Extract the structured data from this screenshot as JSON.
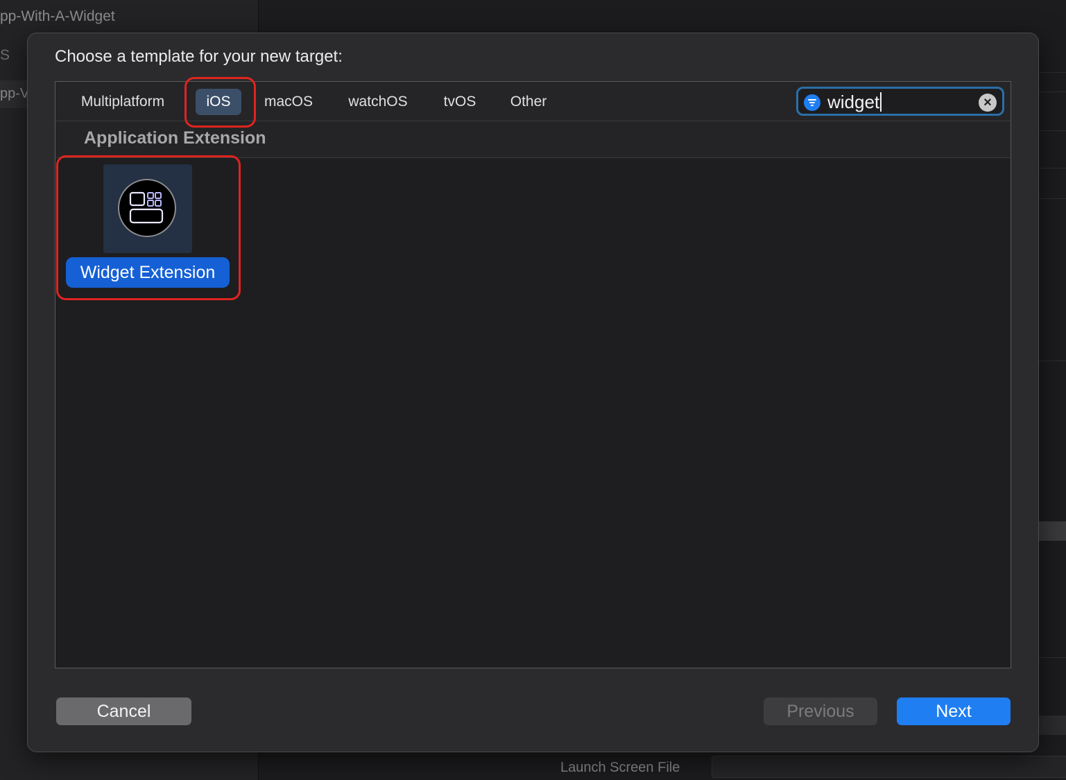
{
  "background": {
    "project_title": "pp-With-A-Widget",
    "sidebar_fragment": "S",
    "sidebar_row": "pp-V",
    "launch_screen_label": "Launch Screen File"
  },
  "sheet": {
    "title": "Choose a template for your new target:",
    "tabs": [
      {
        "label": "Multiplatform",
        "selected": false
      },
      {
        "label": "iOS",
        "selected": true
      },
      {
        "label": "macOS",
        "selected": false
      },
      {
        "label": "watchOS",
        "selected": false
      },
      {
        "label": "tvOS",
        "selected": false
      },
      {
        "label": "Other",
        "selected": false
      }
    ],
    "search": {
      "value": "widget",
      "filter_icon": "line-3-horizontal-decrease-circle-icon",
      "clear_icon": "xmark-circle-icon"
    },
    "section_title": "Application Extension",
    "templates": [
      {
        "label": "Widget Extension",
        "icon": "widget-extension-icon",
        "selected": true
      }
    ],
    "buttons": {
      "cancel": "Cancel",
      "previous": "Previous",
      "next": "Next"
    },
    "annotation_color": "#e0241f",
    "accent_color": "#1f7ef2"
  }
}
